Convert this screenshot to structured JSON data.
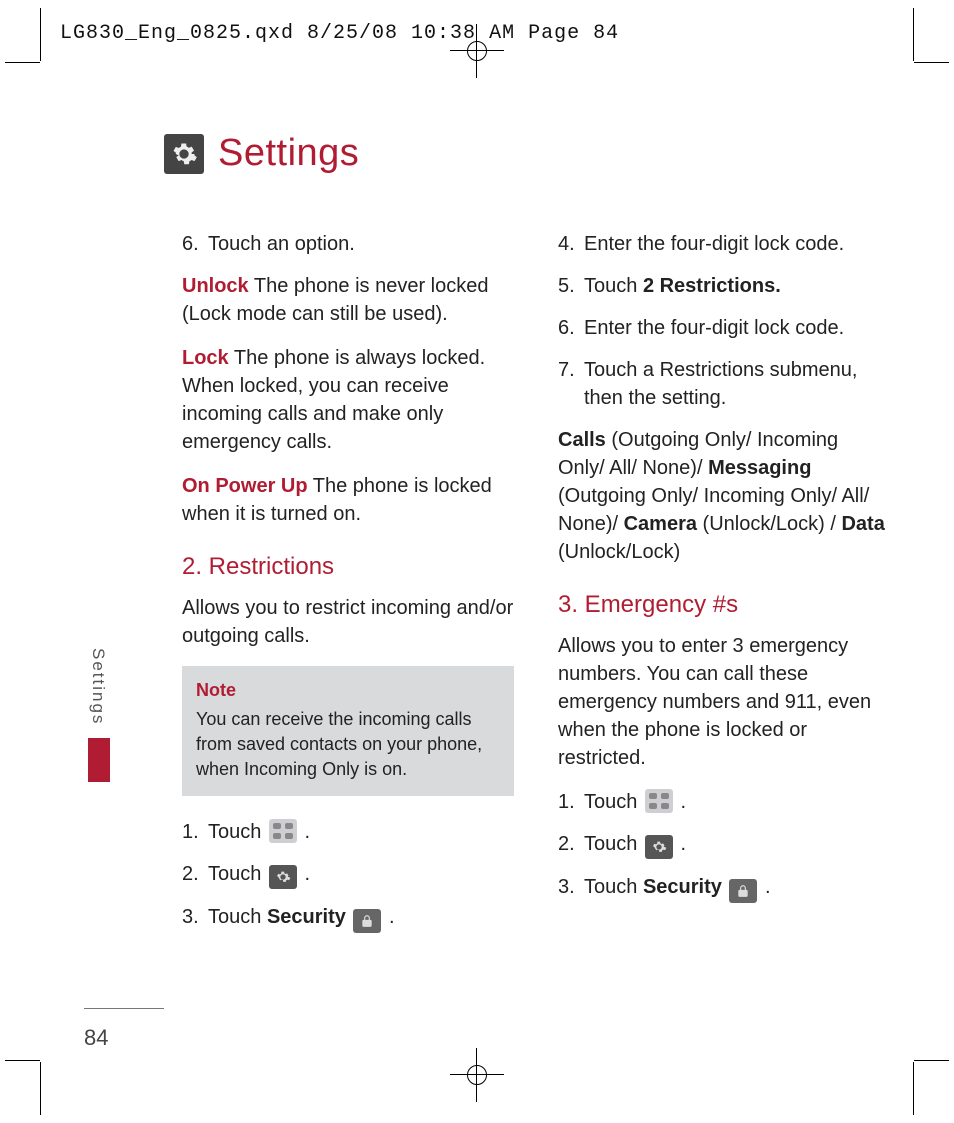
{
  "print_header": "LG830_Eng_0825.qxd  8/25/08  10:38 AM  Page 84",
  "title": "Settings",
  "side_tab": "Settings",
  "page_number": "84",
  "left": {
    "step6_num": "6.",
    "step6_text": "Touch an option.",
    "unlock_label": "Unlock",
    "unlock_text": " The phone is never locked (Lock mode can still be used).",
    "lock_label": "Lock",
    "lock_text": " The phone is always locked. When locked, you can receive incoming calls and make only emergency calls.",
    "onpower_label": "On Power Up",
    "onpower_text": " The phone is locked when it is turned on.",
    "sec2_head": "2. Restrictions",
    "sec2_intro": "Allows you to restrict incoming and/or outgoing calls.",
    "note_label": "Note",
    "note_text": "You can receive the incoming calls from saved contacts on your phone, when Incoming Only is on.",
    "s1_num": "1.",
    "s1_text_a": "Touch ",
    "s1_text_b": ".",
    "s2_num": "2.",
    "s2_text_a": "Touch ",
    "s2_text_b": ".",
    "s3_num": "3.",
    "s3_text_a": "Touch ",
    "s3_bold": "Security",
    "s3_text_b": "."
  },
  "right": {
    "r4_num": "4.",
    "r4_text": "Enter the four-digit lock code.",
    "r5_num": "5.",
    "r5_text_a": "Touch ",
    "r5_bold": "2 Restrictions.",
    "r6_num": "6.",
    "r6_text": "Enter the four-digit lock code.",
    "r7_num": "7.",
    "r7_text": "Touch a Restrictions submenu, then the setting.",
    "r7b_calls_lbl": "Calls",
    "r7b_calls_txt": " (Outgoing Only/ Incoming Only/ All/ None)/ ",
    "r7b_msg_lbl": "Messaging",
    "r7b_msg_txt": " (Outgoing Only/ Incoming Only/ All/ None)/ ",
    "r7b_cam_lbl": "Camera",
    "r7b_cam_txt": " (Unlock/Lock) / ",
    "r7b_data_lbl": "Data",
    "r7b_data_txt": " (Unlock/Lock)",
    "sec3_head": "3. Emergency #s",
    "sec3_intro": "Allows you to enter 3 emergency numbers. You can call these emergency numbers and 911, even when the phone is locked or restricted.",
    "e1_num": "1.",
    "e1_text_a": "Touch ",
    "e1_text_b": ".",
    "e2_num": "2.",
    "e2_text_a": "Touch ",
    "e2_text_b": ".",
    "e3_num": "3.",
    "e3_text_a": "Touch ",
    "e3_bold": "Security",
    "e3_text_b": "."
  }
}
